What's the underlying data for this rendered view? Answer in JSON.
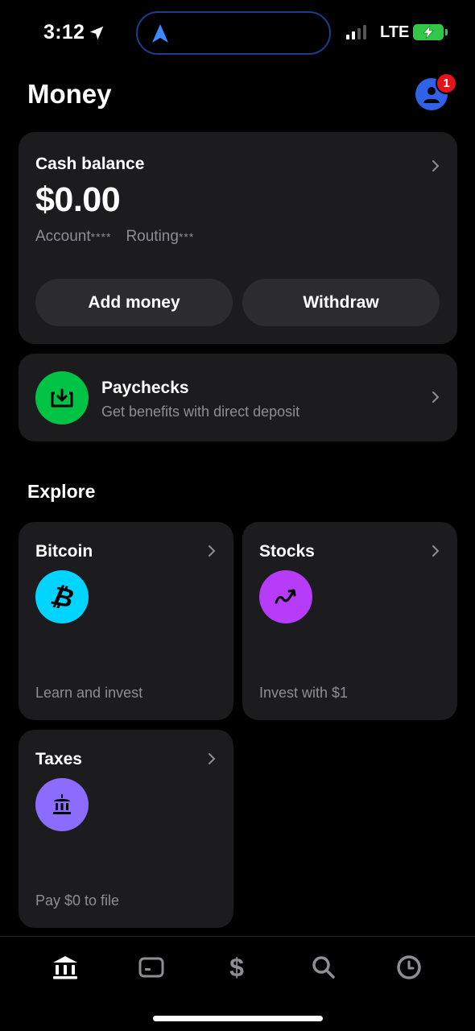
{
  "status_bar": {
    "time": "3:12",
    "network": "LTE"
  },
  "header": {
    "title": "Money",
    "notification_count": "1"
  },
  "cash": {
    "label": "Cash balance",
    "amount": "$0.00",
    "account_label": "Account",
    "account_mask": "****",
    "routing_label": "Routing",
    "routing_mask": "***",
    "add_money_label": "Add money",
    "withdraw_label": "Withdraw"
  },
  "paychecks": {
    "title": "Paychecks",
    "subtitle": "Get benefits with direct deposit",
    "icon": "deposit-icon",
    "icon_color": "#00C244"
  },
  "explore": {
    "title": "Explore",
    "tiles": [
      {
        "title": "Bitcoin",
        "subtitle": "Learn and invest",
        "icon": "bitcoin-icon",
        "color": "#00D4FF"
      },
      {
        "title": "Stocks",
        "subtitle": "Invest with $1",
        "icon": "stocks-icon",
        "color": "#B63CFA"
      },
      {
        "title": "Taxes",
        "subtitle": "Pay $0 to file",
        "icon": "bank-icon",
        "color": "#8B6CFF"
      }
    ]
  },
  "tab_bar": {
    "items": [
      "money-tab",
      "card-tab",
      "pay-tab",
      "search-tab",
      "activity-tab"
    ],
    "active": "money-tab"
  },
  "colors": {
    "background": "#000000",
    "card": "#1C1C1E",
    "button": "#2C2C2E",
    "secondary_text": "#8E8E93",
    "avatar": "#2F62E6",
    "badge": "#E3141A"
  }
}
